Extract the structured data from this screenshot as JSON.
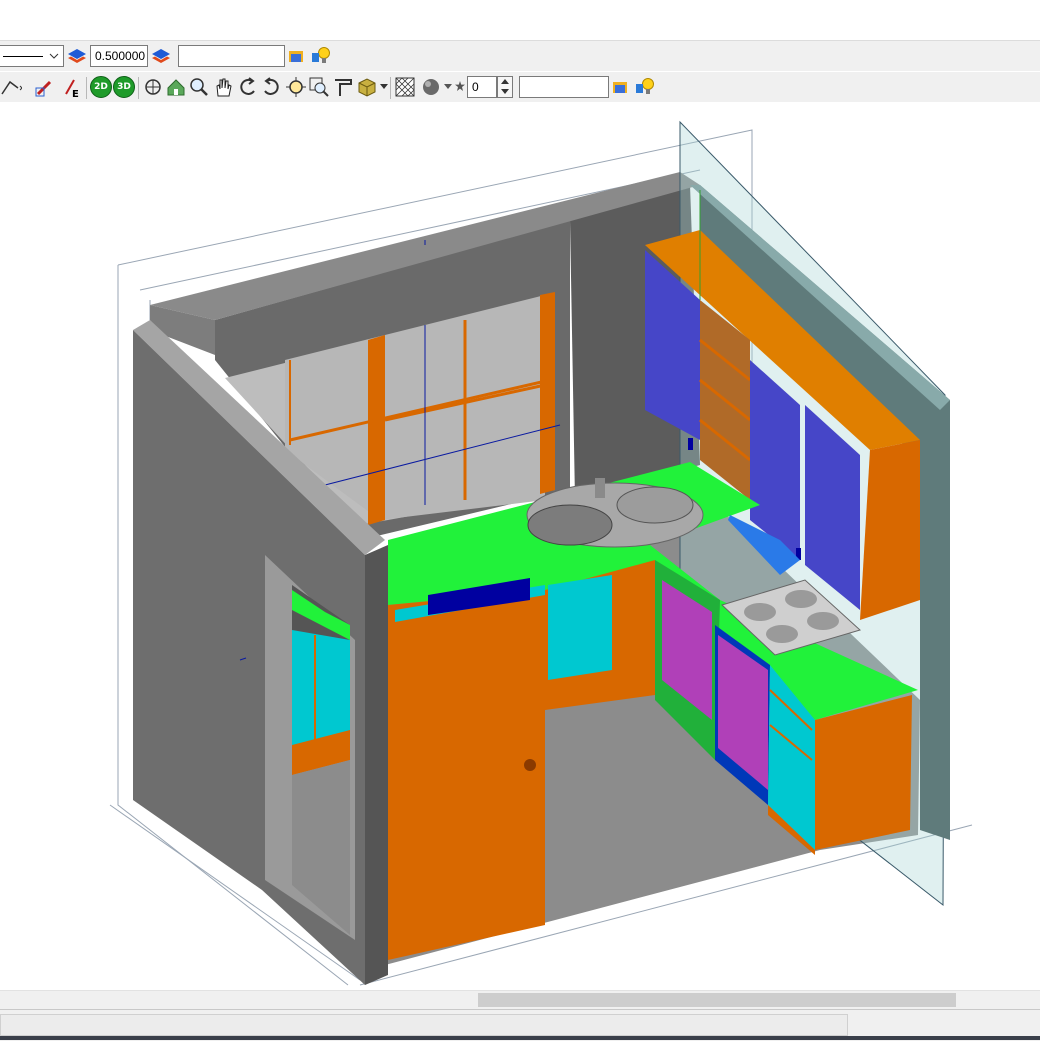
{
  "toolbar1": {
    "linetype_label": "",
    "lineweight_value": "0.500000",
    "layer_field_value": "",
    "icons": [
      "linetype-dropdown-icon",
      "layer-stack-icon",
      "layer-stack-icon",
      "light-bulb-icon"
    ]
  },
  "toolbar2": {
    "btn_2d_label": "2D",
    "btn_3d_label": "3D",
    "spinner_value": "0",
    "name_field_value": "",
    "icons": [
      "draw-arc-icon",
      "edit-icon",
      "section-e-icon",
      "view-2d-icon",
      "view-3d-icon",
      "orbit-icon",
      "walk-icon",
      "zoom-window-icon",
      "pan-hand-icon",
      "rotate-left-icon",
      "rotate-right-icon",
      "zoom-extents-icon",
      "zoom-previous-icon",
      "measure-icon",
      "render-box-icon",
      "hatch-icon",
      "material-sphere-icon",
      "layer-stack-icon",
      "light-bulb-icon"
    ]
  },
  "colors": {
    "wall_grey": "#7a7a7a",
    "wall_dark": "#555555",
    "counter_green": "#21f23a",
    "cabinet_orange": "#d86800",
    "door_blue": "#4646c8",
    "cabinet_magenta": "#b040b8",
    "cabinet_cyan": "#00c8d0",
    "sink_grey": "#9a9a9a",
    "accent_blue": "#0000a0"
  }
}
